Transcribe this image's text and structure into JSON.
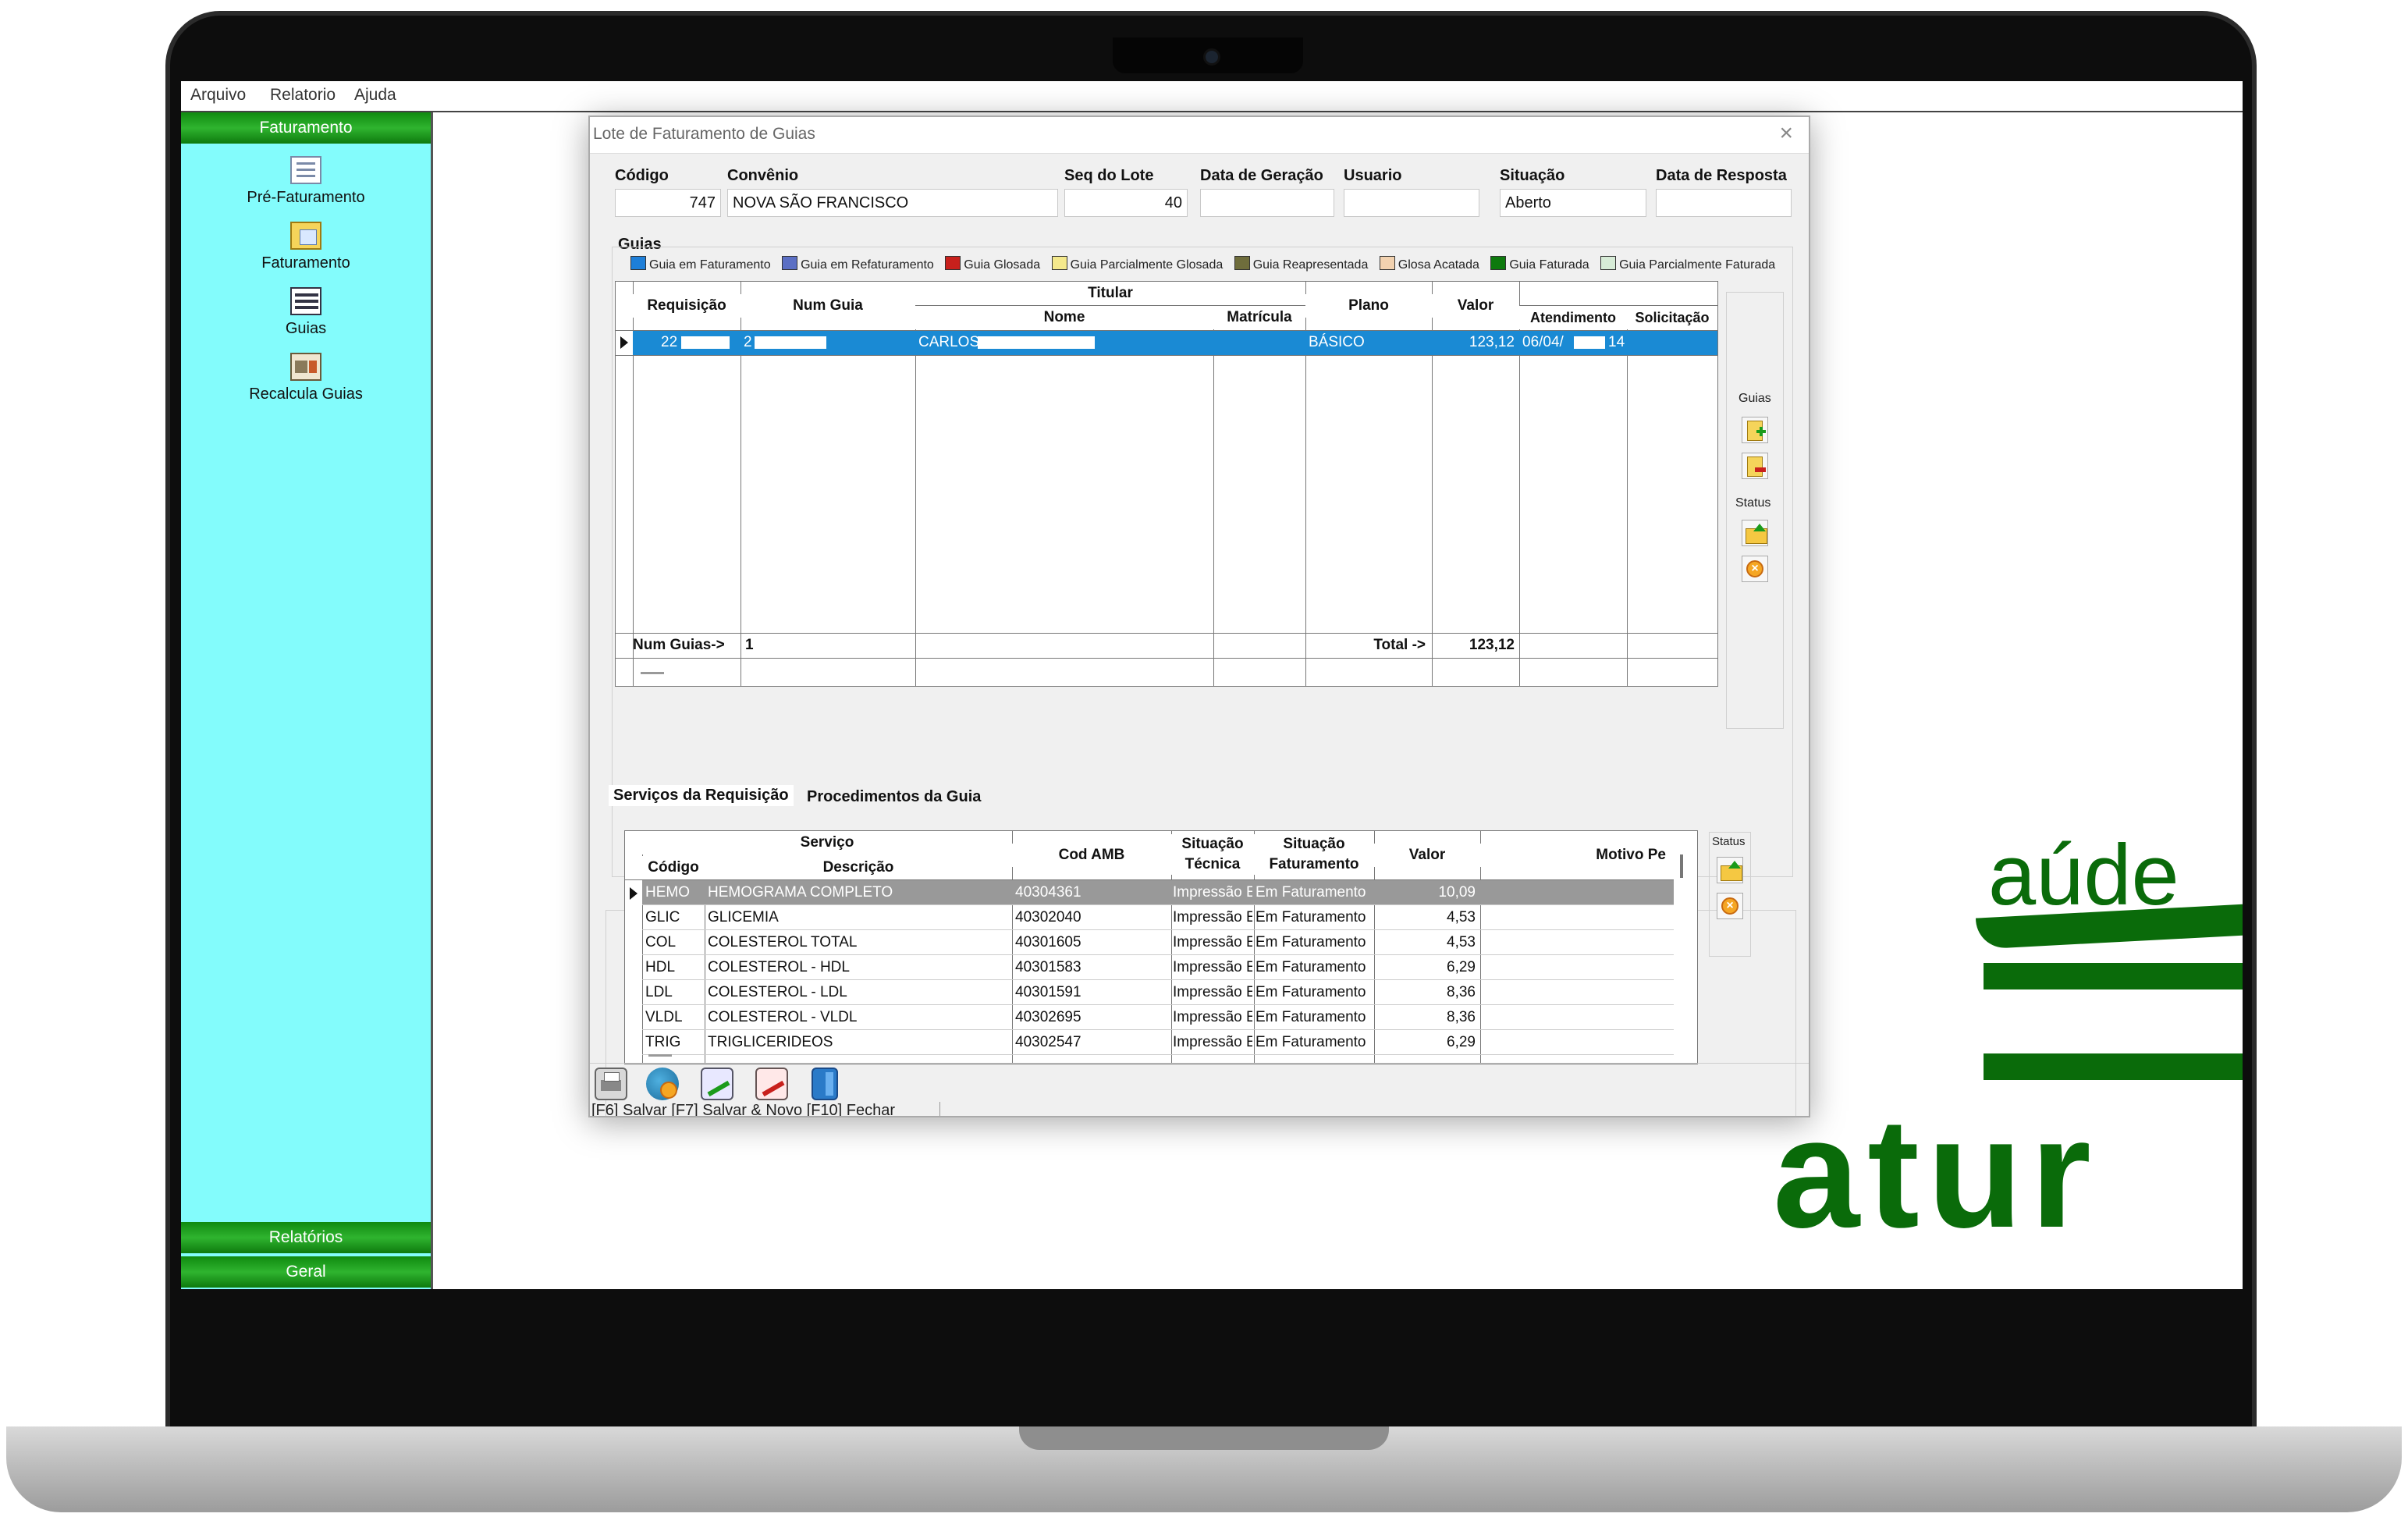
{
  "menu": [
    "Arquivo",
    "Relatorio",
    "Ajuda"
  ],
  "sidebar": {
    "header": "Faturamento",
    "items": [
      {
        "label": "Pré-Faturamento",
        "icon": "document-stack-icon"
      },
      {
        "label": "Faturamento",
        "icon": "invoice-icon"
      },
      {
        "label": "Guias",
        "icon": "list-icon"
      },
      {
        "label": "Recalcula Guias",
        "icon": "calculator-icon"
      }
    ],
    "footer": [
      "Relatórios",
      "Geral"
    ]
  },
  "background_logo": {
    "text1": "aúde",
    "text2": "atur"
  },
  "dialog": {
    "title": "Lote de Faturamento de Guias",
    "fields": {
      "codigo_label": "Código",
      "codigo": "747",
      "convenio_label": "Convênio",
      "convenio": "NOVA SÃO FRANCISCO",
      "seq_label": "Seq do Lote",
      "seq": "40",
      "data_geracao_label": "Data de Geração",
      "data_geracao": "",
      "usuario_label": "Usuario",
      "usuario": "",
      "situacao_label": "Situação",
      "situacao": "Aberto",
      "data_resposta_label": "Data de Resposta",
      "data_resposta": ""
    },
    "guias_label": "Guias",
    "legend": [
      {
        "label": "Guia em Faturamento",
        "color": "#1e7fd8"
      },
      {
        "label": "Guia em Refaturamento",
        "color": "#5b6fc4"
      },
      {
        "label": "Guia Glosada",
        "color": "#c8201c"
      },
      {
        "label": "Guia Parcialmente Glosada",
        "color": "#f4e98c"
      },
      {
        "label": "Guia Reapresentada",
        "color": "#6f6d3c"
      },
      {
        "label": "Glosa Acatada",
        "color": "#f2d2b0"
      },
      {
        "label": "Guia Faturada",
        "color": "#0e7a0e"
      },
      {
        "label": "Guia Parcialmente Faturada",
        "color": "#d7ecd7"
      }
    ],
    "guias_table": {
      "headers": {
        "requisicao": "Requisição",
        "num_guia": "Num Guia",
        "titular": "Titular",
        "nome": "Nome",
        "matricula": "Matrícula",
        "plano": "Plano",
        "valor": "Valor",
        "atendimento": "Atendimento",
        "solicitacao": "Solicitação"
      },
      "row": {
        "requisicao": "22",
        "num_guia": "2",
        "nome": "CARLOS",
        "matricula": "",
        "plano": "BÁSICO",
        "valor": "123,12",
        "atendimento": "06/04/",
        "atendimento_tail": "14",
        "solicitacao": ""
      },
      "footer": {
        "num_guias_label": "Num Guias->",
        "num_guias": "1",
        "total_label": "Total ->",
        "total": "123,12"
      }
    },
    "side_guias_label": "Guias",
    "side_status_label": "Status",
    "tabs": [
      "Serviços da Requisição",
      "Procedimentos da Guia"
    ],
    "servicos_table": {
      "headers": {
        "servico": "Serviço",
        "codigo": "Código",
        "descricao": "Descrição",
        "cod_amb": "Cod AMB",
        "sit_tecnica": "Situação Técnica",
        "sit_faturamento": "Situação Faturamento",
        "valor": "Valor",
        "motivo": "Motivo Pe"
      },
      "rows": [
        {
          "codigo": "HEMO",
          "descricao": "HEMOGRAMA COMPLETO",
          "cod_amb": "40304361",
          "sit_tecnica": "Impressão E",
          "sit_faturamento": "Em Faturamento",
          "valor": "10,09"
        },
        {
          "codigo": "GLIC",
          "descricao": "GLICEMIA",
          "cod_amb": "40302040",
          "sit_tecnica": "Impressão E",
          "sit_faturamento": "Em Faturamento",
          "valor": "4,53"
        },
        {
          "codigo": "COL",
          "descricao": "COLESTEROL TOTAL",
          "cod_amb": "40301605",
          "sit_tecnica": "Impressão E",
          "sit_faturamento": "Em Faturamento",
          "valor": "4,53"
        },
        {
          "codigo": "HDL",
          "descricao": "COLESTEROL - HDL",
          "cod_amb": "40301583",
          "sit_tecnica": "Impressão E",
          "sit_faturamento": "Em Faturamento",
          "valor": "6,29"
        },
        {
          "codigo": "LDL",
          "descricao": "COLESTEROL - LDL",
          "cod_amb": "40301591",
          "sit_tecnica": "Impressão E",
          "sit_faturamento": "Em Faturamento",
          "valor": "8,36"
        },
        {
          "codigo": "VLDL",
          "descricao": "COLESTEROL - VLDL",
          "cod_amb": "40302695",
          "sit_tecnica": "Impressão E",
          "sit_faturamento": "Em Faturamento",
          "valor": "8,36"
        },
        {
          "codigo": "TRIG",
          "descricao": "TRIGLICERIDEOS",
          "cod_amb": "40302547",
          "sit_tecnica": "Impressão E",
          "sit_faturamento": "Em Faturamento",
          "valor": "6,29"
        }
      ]
    },
    "toolbar": [
      "printer-icon",
      "globe-refresh-icon",
      "document-edit-icon",
      "document-delete-icon",
      "exit-door-icon"
    ],
    "status_bar": "[F6] Salvar [F7] Salvar & Novo [F10] Fechar"
  }
}
